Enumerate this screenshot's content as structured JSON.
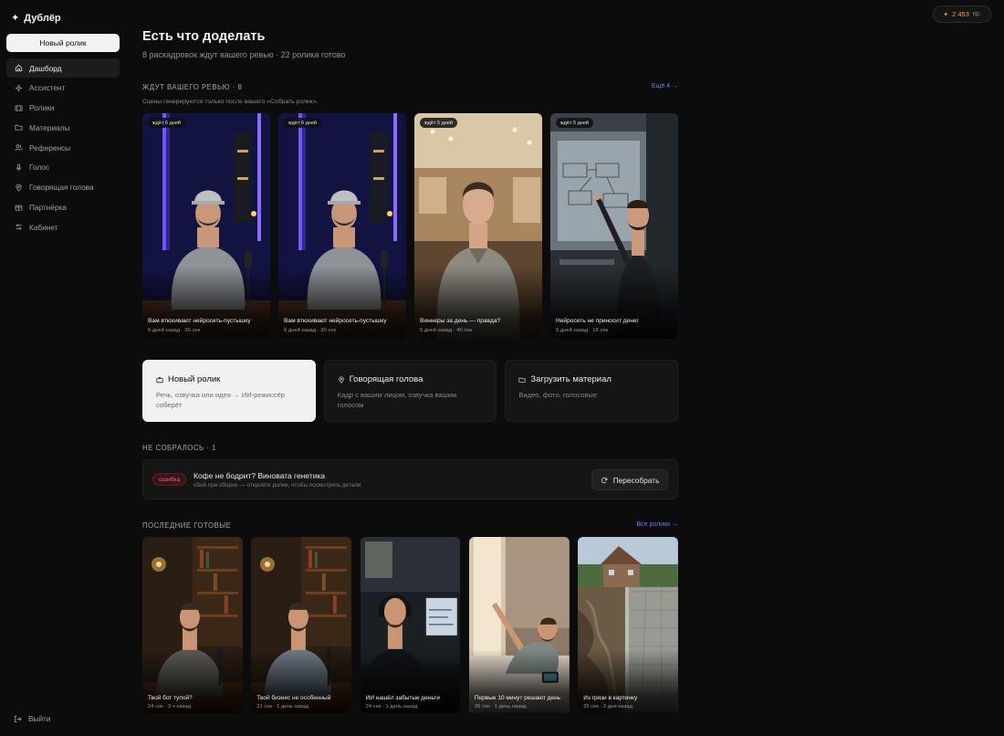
{
  "app": {
    "name": "Дублёр",
    "new_button": "Новый ролик"
  },
  "nav": [
    {
      "label": "Дашборд",
      "icon": "home-icon",
      "active": true
    },
    {
      "label": "Ассистент",
      "icon": "sparkle-icon"
    },
    {
      "label": "Ролики",
      "icon": "film-icon"
    },
    {
      "label": "Материалы",
      "icon": "folder-icon"
    },
    {
      "label": "Референсы",
      "icon": "users-icon"
    },
    {
      "label": "Голос",
      "icon": "mic-icon"
    },
    {
      "label": "Говорящая голова",
      "icon": "pin-icon"
    },
    {
      "label": "Партнёрка",
      "icon": "partner-icon"
    },
    {
      "label": "Кабинет",
      "icon": "sliders-icon"
    }
  ],
  "logout": "Выйти",
  "credits": {
    "amount": "2 453",
    "unit": "кр."
  },
  "page": {
    "title": "Есть что доделать",
    "subtitle": "8 раскадровок ждут вашего ревью · 22 ролика готово"
  },
  "review": {
    "title": "Ждут вашего ревью · 8",
    "more": "Ещё 4 →",
    "note": "Сцены генерируются только после вашего «Собрать ролик».",
    "items": [
      {
        "badge": "ждёт 6 дней",
        "title": "Вам втюхивают нейросеть-пустышку",
        "meta": "6 дней назад · 30 сек",
        "scene": "studio"
      },
      {
        "badge": "ждёт 6 дней",
        "title": "Вам втюхивают нейросеть-пустышку",
        "meta": "6 дней назад · 30 сек",
        "scene": "studio"
      },
      {
        "badge": "ждёт 5 дней",
        "title": "Виннеры за день — правда?",
        "meta": "5 дней назад · 40 сек",
        "scene": "kitchen"
      },
      {
        "badge": "ждёт 5 дней",
        "title": "Нейросеть не приносит денег",
        "meta": "5 дней назад · 18 сек",
        "scene": "office"
      }
    ]
  },
  "actions": [
    {
      "icon": "camera-icon",
      "title": "Новый ролик",
      "desc": "Речь, озвучка или идея → ИИ-режиссёр соберёт"
    },
    {
      "icon": "pin-icon",
      "title": "Говорящая голова",
      "desc": "Кадр с вашим лицом, озвучка вашим голосом"
    },
    {
      "icon": "folder-icon",
      "title": "Загрузить материал",
      "desc": "Видео, фото, голосовые"
    }
  ],
  "failed": {
    "title": "Не собралось · 1",
    "badge": "ошибка",
    "item_title": "Кофе не бодрит? Виновата генетика",
    "item_desc": "сбой при сборке — откройте ролик, чтобы посмотреть детали",
    "button": "Пересобрать"
  },
  "ready": {
    "title": "Последние готовые",
    "more": "Все ролики →",
    "items": [
      {
        "title": "Твой бот тупой?",
        "meta": "24 сек · 3 ч назад",
        "scene": "library"
      },
      {
        "title": "Твой бизнес не особенный",
        "meta": "21 сек · 1 день назад",
        "scene": "library"
      },
      {
        "title": "ИИ нашёл забытые деньги",
        "meta": "24 сек · 1 день назад",
        "scene": "desk"
      },
      {
        "title": "Первые 10 минут решают день",
        "meta": "26 сек · 1 день назад",
        "scene": "bedroom"
      },
      {
        "title": "Из грязи в картинку",
        "meta": "25 сек · 2 дня назад",
        "scene": "yard"
      }
    ]
  }
}
